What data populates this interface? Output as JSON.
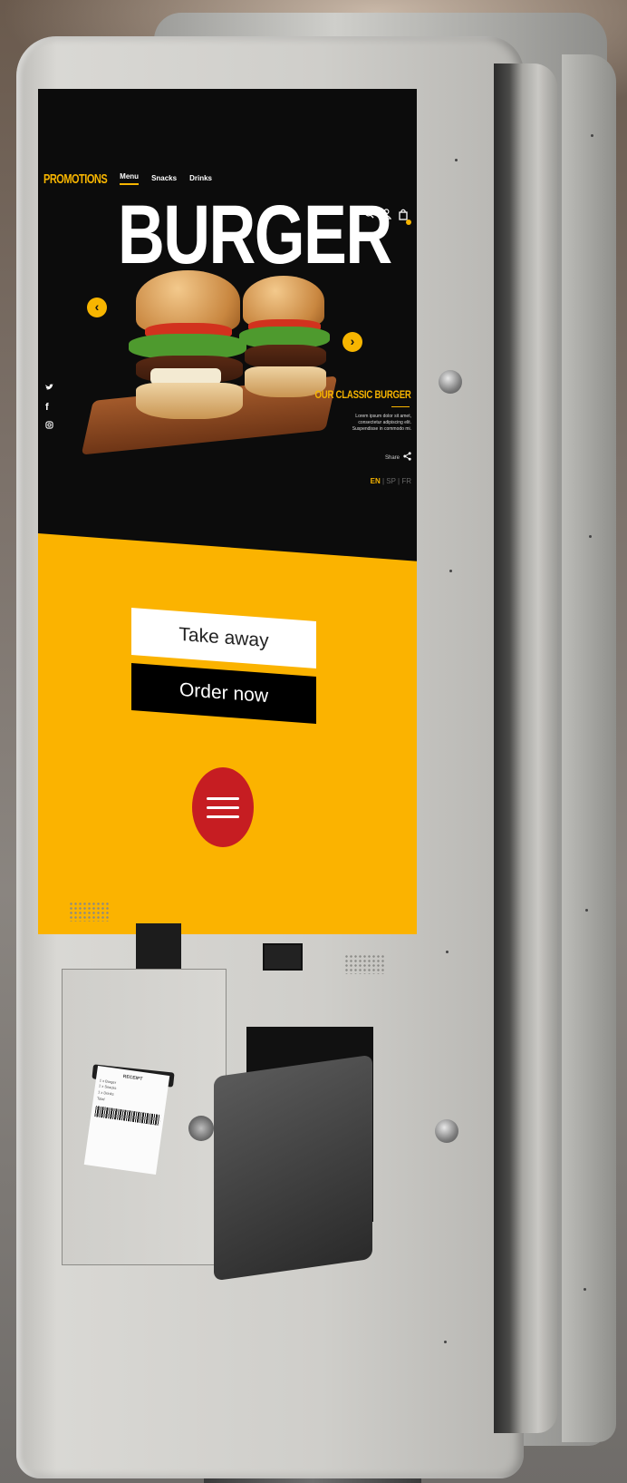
{
  "nav": {
    "promotions": "PROMOTIONS",
    "menu": "Menu",
    "snacks": "Snacks",
    "drinks": "Drinks"
  },
  "header_icons": [
    "search-icon",
    "user-icon",
    "cart-icon"
  ],
  "hero": {
    "headline": "BURGER",
    "prev_label": "‹",
    "next_label": "›"
  },
  "socials": [
    "twitter-icon",
    "facebook-icon",
    "instagram-icon"
  ],
  "promo": {
    "title": "OUR CLASSIC BURGER",
    "description": "Lorem ipsum dolor sit amet, consectetur adipiscing elit. Suspendisse in commodo mi.",
    "share_label": "Share"
  },
  "languages": {
    "active": "EN",
    "others": "| SP | FR"
  },
  "actions": {
    "take_away": "Take away",
    "order_now": "Order now"
  },
  "receipt": {
    "header": "RECEIPT",
    "lines": [
      "1 x Burger",
      "1 x Snacks",
      "1 x Drinks",
      "Total"
    ]
  },
  "colors": {
    "accent": "#fbb300",
    "menu_button": "#c61d22",
    "screen_bg": "#0c0c0c"
  }
}
